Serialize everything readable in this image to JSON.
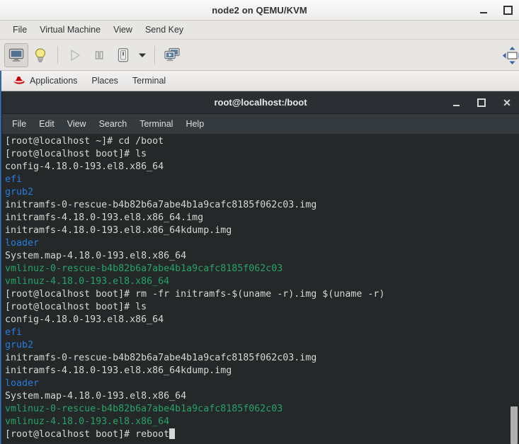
{
  "vm_window": {
    "title": "node2 on QEMU/KVM",
    "controls": [
      {
        "name": "minimize",
        "icon": "minimize-icon"
      },
      {
        "name": "maximize",
        "icon": "maximize-icon"
      }
    ],
    "menubar": [
      "File",
      "Virtual Machine",
      "View",
      "Send Key"
    ],
    "toolbar": [
      {
        "name": "show-console",
        "icon": "monitor-icon",
        "state": "active"
      },
      {
        "name": "show-details",
        "icon": "lightbulb-icon",
        "state": "normal"
      },
      {
        "name": "run",
        "icon": "play-icon",
        "state": "disabled"
      },
      {
        "name": "pause",
        "icon": "pause-icon",
        "state": "normal"
      },
      {
        "name": "shutdown",
        "icon": "power-icon",
        "state": "normal"
      },
      {
        "name": "shutdown-options",
        "icon": "chevron-down-icon",
        "state": "normal"
      },
      {
        "name": "snapshots",
        "icon": "snapshots-icon",
        "state": "normal"
      },
      {
        "name": "fullscreen",
        "icon": "fullscreen-icon",
        "state": "normal"
      }
    ]
  },
  "guest": {
    "panel": {
      "logo": "redhat-logo-icon",
      "items": [
        "Applications",
        "Places",
        "Terminal"
      ]
    },
    "terminal": {
      "title": "root@localhost:/boot",
      "controls": [
        {
          "name": "minimize",
          "icon": "minimize-icon",
          "glyph": ""
        },
        {
          "name": "maximize",
          "icon": "maximize-icon",
          "glyph": ""
        },
        {
          "name": "close",
          "icon": "close-icon",
          "glyph": "✕"
        }
      ],
      "menubar": [
        "File",
        "Edit",
        "View",
        "Search",
        "Terminal",
        "Help"
      ],
      "scrollbar": {
        "thumb_top_pct": 88,
        "thumb_height_pct": 12
      },
      "colors": {
        "background": "#242829",
        "foreground": "#d7d7d7",
        "directory": "#2a7bde",
        "executable": "#26a269"
      },
      "lines": [
        {
          "segments": [
            {
              "t": "[root@localhost ~]# cd /boot",
              "c": "fg"
            }
          ]
        },
        {
          "segments": [
            {
              "t": "[root@localhost boot]# ls",
              "c": "fg"
            }
          ]
        },
        {
          "segments": [
            {
              "t": "config-4.18.0-193.el8.x86_64",
              "c": "fg"
            }
          ]
        },
        {
          "segments": [
            {
              "t": "efi",
              "c": "dir"
            }
          ]
        },
        {
          "segments": [
            {
              "t": "grub2",
              "c": "dir"
            }
          ]
        },
        {
          "segments": [
            {
              "t": "initramfs-0-rescue-b4b82b6a7abe4b1a9cafc8185f062c03.img",
              "c": "fg"
            }
          ]
        },
        {
          "segments": [
            {
              "t": "initramfs-4.18.0-193.el8.x86_64.img",
              "c": "fg"
            }
          ]
        },
        {
          "segments": [
            {
              "t": "initramfs-4.18.0-193.el8.x86_64kdump.img",
              "c": "fg"
            }
          ]
        },
        {
          "segments": [
            {
              "t": "loader",
              "c": "dir"
            }
          ]
        },
        {
          "segments": [
            {
              "t": "System.map-4.18.0-193.el8.x86_64",
              "c": "fg"
            }
          ]
        },
        {
          "segments": [
            {
              "t": "vmlinuz-0-rescue-b4b82b6a7abe4b1a9cafc8185f062c03",
              "c": "exec"
            }
          ]
        },
        {
          "segments": [
            {
              "t": "vmlinuz-4.18.0-193.el8.x86_64",
              "c": "exec"
            }
          ]
        },
        {
          "segments": [
            {
              "t": "[root@localhost boot]# rm -fr initramfs-$(uname -r).img $(uname -r)",
              "c": "fg"
            }
          ]
        },
        {
          "segments": [
            {
              "t": "[root@localhost boot]# ls",
              "c": "fg"
            }
          ]
        },
        {
          "segments": [
            {
              "t": "config-4.18.0-193.el8.x86_64",
              "c": "fg"
            }
          ]
        },
        {
          "segments": [
            {
              "t": "efi",
              "c": "dir"
            }
          ]
        },
        {
          "segments": [
            {
              "t": "grub2",
              "c": "dir"
            }
          ]
        },
        {
          "segments": [
            {
              "t": "initramfs-0-rescue-b4b82b6a7abe4b1a9cafc8185f062c03.img",
              "c": "fg"
            }
          ]
        },
        {
          "segments": [
            {
              "t": "initramfs-4.18.0-193.el8.x86_64kdump.img",
              "c": "fg"
            }
          ]
        },
        {
          "segments": [
            {
              "t": "loader",
              "c": "dir"
            }
          ]
        },
        {
          "segments": [
            {
              "t": "System.map-4.18.0-193.el8.x86_64",
              "c": "fg"
            }
          ]
        },
        {
          "segments": [
            {
              "t": "vmlinuz-0-rescue-b4b82b6a7abe4b1a9cafc8185f062c03",
              "c": "exec"
            }
          ]
        },
        {
          "segments": [
            {
              "t": "vmlinuz-4.18.0-193.el8.x86_64",
              "c": "exec"
            }
          ]
        },
        {
          "segments": [
            {
              "t": "[root@localhost boot]# reboot",
              "c": "fg"
            },
            {
              "t": "",
              "c": "cursor"
            }
          ]
        }
      ]
    }
  }
}
